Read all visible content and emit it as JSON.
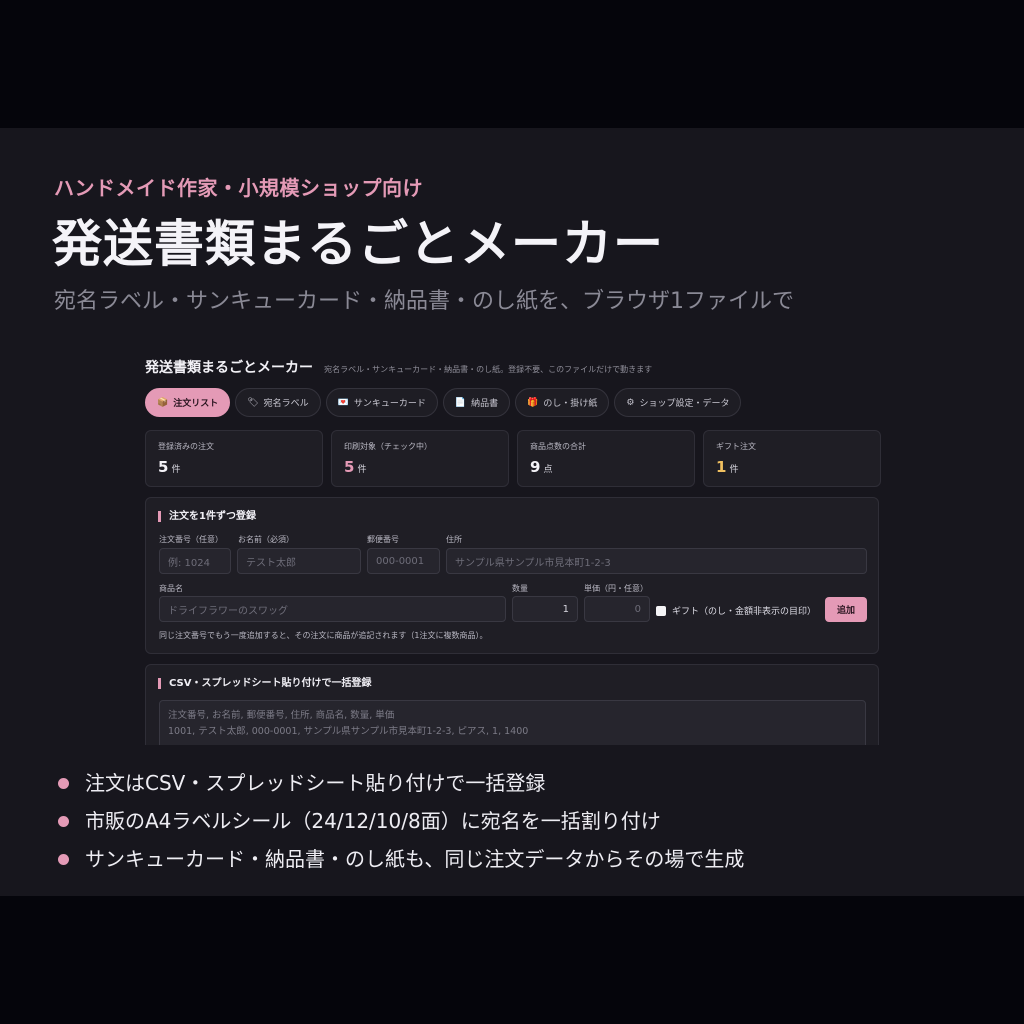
{
  "hero": {
    "kicker": "ハンドメイド作家・小規模ショップ向け",
    "title": "発送書類まるごとメーカー",
    "tagline": "宛名ラベル・サンキューカード・納品書・のし紙を、ブラウザ1ファイルで"
  },
  "app": {
    "title": "発送書類まるごとメーカー",
    "subtitle": "宛名ラベル・サンキューカード・納品書・のし紙。登録不要、このファイルだけで動きます",
    "tabs": [
      {
        "label": "注文リスト",
        "icon": "📦"
      },
      {
        "label": "宛名ラベル",
        "icon": "🏷"
      },
      {
        "label": "サンキューカード",
        "icon": "💌"
      },
      {
        "label": "納品書",
        "icon": "📄"
      },
      {
        "label": "のし・掛け紙",
        "icon": "🎁"
      },
      {
        "label": "ショップ設定・データ",
        "icon": "⚙"
      }
    ],
    "stats": [
      {
        "label": "登録済みの注文",
        "value": "5",
        "unit": "件"
      },
      {
        "label": "印刷対象（チェック中）",
        "value": "5",
        "unit": "件"
      },
      {
        "label": "商品点数の合計",
        "value": "9",
        "unit": "点"
      },
      {
        "label": "ギフト注文",
        "value": "1",
        "unit": "件"
      }
    ],
    "single_form": {
      "title": "注文を1件ずつ登録",
      "order_no_label": "注文番号（任意）",
      "order_no_placeholder": "例: 1024",
      "name_label": "お名前（必須）",
      "name_placeholder": "テスト太郎",
      "zip_label": "郵便番号",
      "zip_placeholder": "000-0001",
      "address_label": "住所",
      "address_placeholder": "サンプル県サンプル市見本町1-2-3",
      "product_label": "商品名",
      "product_placeholder": "ドライフラワーのスワッグ",
      "qty_label": "数量",
      "qty_value": "1",
      "price_label": "単価（円・任意）",
      "price_value": "0",
      "gift_label": "ギフト（のし・金額非表示の目印）",
      "add_label": "追加",
      "note": "同じ注文番号でもう一度追加すると、その注文に商品が追記されます（1注文に複数商品）。"
    },
    "bulk_form": {
      "title": "CSV・スプレッドシート貼り付けで一括登録",
      "placeholder_line1": "注文番号, お名前, 郵便番号, 住所, 商品名, 数量, 単価",
      "placeholder_line2": "1001, テスト太郎, 000-0001, サンプル県サンプル市見本町1-2-3, ピアス, 1, 1400"
    }
  },
  "bullets": [
    "注文はCSV・スプレッドシート貼り付けで一括登録",
    "市販のA4ラベルシール（24/12/10/8面）に宛名を一括割り付け",
    "サンキューカード・納品書・のし紙も、同じ注文データからその場で生成"
  ],
  "colors": {
    "accent": "#e49ab6",
    "gift": "#f0c060",
    "panel": "#17161d"
  }
}
